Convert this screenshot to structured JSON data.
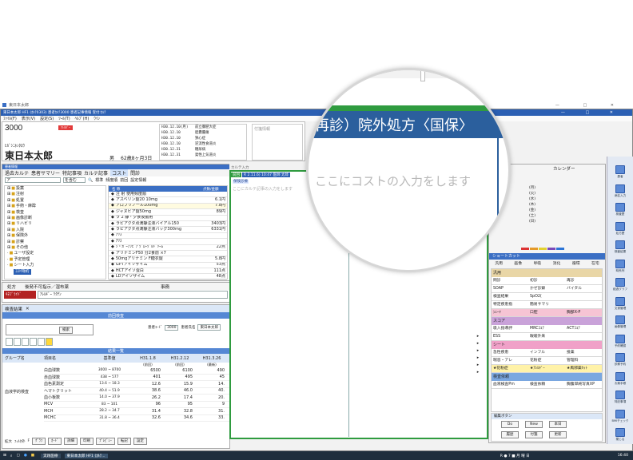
{
  "app": {
    "outer_title": "東日本太郎",
    "title": "東日本太郎 HF1 (ｶﾙﾃ0303) 患者ｶﾙﾃ3000 患者記事情報 受付:ｶﾙﾃ",
    "menus": [
      "ﾌｧｲﾙ(F)",
      "表示(V)",
      "設定(S)",
      "ﾂｰﾙ(T)",
      "ﾍﾙﾌﾟ(H)",
      "ｳｲﾝ"
    ]
  },
  "patient": {
    "id": "3000",
    "badge": "ｱﾚﾙｷﾞｰ",
    "kana": "ﾋｶﾞｼﾆﾎﾝﾀﾛｳ",
    "name": "東日本太郎",
    "sex": "男",
    "age": "62歳8ヶ月3日",
    "dates": [
      {
        "d": "H30.12.10(月)",
        "t": "前立腺肥大症"
      },
      {
        "d": "H30.12.10",
        "t": "胆嚢腫瘍"
      },
      {
        "d": "H30.12.10",
        "t": "狭心症"
      },
      {
        "d": "H30.12.10",
        "t": "逆流性食道炎"
      },
      {
        "d": "H30.12.31",
        "t": "糖尿病"
      },
      {
        "d": "H30.12.31",
        "t": "発性上気道炎"
      }
    ],
    "sticky": "付箋情報"
  },
  "left_panel": {
    "title": "患者情報",
    "tabs": [
      "過去カルテ",
      "患者サマリー",
      "特記事項",
      "カルテ記事",
      "コスト",
      "問診"
    ],
    "search_value": "ア",
    "search_mode": "を含む",
    "std_label": "標準",
    "checks": [
      "頻度順",
      "前回"
    ],
    "settings_label": "設定情報",
    "tree": [
      "投薬",
      "注射",
      "処置",
      "手術・麻酔",
      "検査",
      "画像診断",
      "リハビリ",
      "入院",
      "保険外",
      "診察",
      "その他",
      "ユーザ設定",
      "予定管理",
      "シート入力"
    ],
    "tree_selected": "ｺｽﾄ特約",
    "list_header": [
      "名 称",
      "点数/金額"
    ],
    "list": [
      {
        "n": "注 射 使用頻度順",
        "v": ""
      },
      {
        "n": "アスベリン錠20 10mg",
        "v": "6.1円"
      },
      {
        "n": "アロプリノール100mg",
        "v": "7.8円"
      },
      {
        "n": "ジャヌビア錠50mg",
        "v": "89円"
      },
      {
        "n": "ラ 2 静・夕食後服用",
        "v": ""
      },
      {
        "n": "ラピアクタ点滴静注液バイアル150",
        "v": "3403円"
      },
      {
        "n": "ラピアクタ点滴静注液バッグ300mg",
        "v": "6331円"
      },
      {
        "n": "ｱﾘｽ",
        "v": ""
      },
      {
        "n": "ｱﾘｽ",
        "v": ""
      },
      {
        "n": "ｼ・ｶﾞｰｱﾝﾋﾞｱ ｸﾞﾛｰｸﾞﾙﾄﾞﾘｰﾑ",
        "v": "22点"
      },
      {
        "n": "アリナミンF50 分2食前 ×7",
        "v": ""
      },
      {
        "n": "50mgアリナミン F糖衣錠",
        "v": "5.8円"
      },
      {
        "n": "GPTアイソザイム",
        "v": "53点"
      },
      {
        "n": "HCTアイソ蛋白",
        "v": "111点"
      },
      {
        "n": "LDアイソザイム",
        "v": "48点"
      }
    ],
    "memo_cols": [
      "処方",
      "後発不可指示／湿布薬",
      "事務"
    ],
    "memo_tag": "ｷﾈﾌﾞﾗｲﾄﾞ",
    "memo_text": "ｱﾚﾙｷﾞｰ ﾜｸﾁﾝ"
  },
  "results": {
    "tab": "検査結果",
    "header": "前回検査",
    "labels": {
      "item": "項目名",
      "range": "基準値",
      "group": "グループ名",
      "group_value": "血液学的検査",
      "code_label": "患者ｺｰﾄﾞ",
      "code": "3000",
      "name_label": "患者氏名",
      "name": "東日本太郎",
      "table_title": "結果一覧",
      "btn": "検索"
    },
    "dates": [
      "H31.1.8",
      "H31.2.12",
      "H31.3.26"
    ],
    "sub": [
      "(前回)",
      "(前回)",
      "(最新)"
    ],
    "rows": [
      {
        "n": "白血球数",
        "r": "3000 ~ 8700",
        "v": [
          "6500",
          "6100",
          "490"
        ]
      },
      {
        "n": "赤血球数",
        "r": "438 ~ 577",
        "v": [
          "401",
          "495",
          "45"
        ]
      },
      {
        "n": "血色素測定",
        "r": "13.6 ~ 18.3",
        "v": [
          "12.6",
          "15.9",
          "14."
        ]
      },
      {
        "n": "ヘマトクリット",
        "r": "40.4 ~ 51.9",
        "v": [
          "38.6",
          "46.0",
          "40."
        ]
      },
      {
        "n": "血小板数",
        "r": "14.0 ~ 37.9",
        "v": [
          "26.2",
          "17.4",
          "20."
        ]
      },
      {
        "n": "MCV",
        "r": "83 ~ 101",
        "v": [
          "96",
          "95",
          "9"
        ]
      },
      {
        "n": "MCH",
        "r": "28.2 ~ 34.7",
        "v": [
          "31.4",
          "32.8",
          "31."
        ]
      },
      {
        "n": "MCHC",
        "r": "31.8 ~ 36.4",
        "v": [
          "32.6",
          "34.6",
          "33."
        ]
      }
    ],
    "footer_checks": [
      "拡大",
      "ﾌｨﾙﾀ外",
      "F"
    ],
    "footer_buttons": [
      "ｸﾞﾗﾌ",
      "ｶｰﾄﾞ",
      "詳細",
      "印刷",
      "ﾌﾟﾚﾋﾞｭｰ",
      "転記",
      "設定"
    ]
  },
  "karte": {
    "tab_active": "前回",
    "line": "R 2.11.6) 10:47 医師 太郎",
    "sub_tag": "保険診療",
    "placeholder": "ここにカルテ記事の入力をします",
    "title_hint": "カルテ入力"
  },
  "magnifier": {
    "order_text": "再診）院外処方〈国保〉",
    "cost_placeholder": "ここにコストの入力をします"
  },
  "right_panel": {
    "calendar_title": "カレンダー",
    "weekdays": [
      "(月)",
      "(火)",
      "(水)",
      "(木)",
      "(金)",
      "(土)",
      "(日)"
    ],
    "shortcut_title": "ショートカット",
    "tabs": [
      "汎用",
      "画像",
      "呼吸",
      "消化",
      "循環",
      "在宅"
    ],
    "sections": [
      {
        "type": "head",
        "label": "汎用",
        "color": "#e9d6a6"
      },
      {
        "type": "row",
        "cells": [
          "問診",
          "初診",
          "再診"
        ]
      },
      {
        "type": "row",
        "cells": [
          "SOAP",
          "かぜ診察",
          "バイタル"
        ]
      },
      {
        "type": "row",
        "cells": [
          "検査結果",
          "SpO2(",
          ""
        ]
      },
      {
        "type": "row",
        "cells": [
          "特定疾患指",
          "簡易サマリ",
          ""
        ]
      },
      {
        "type": "pinkrow",
        "cells": [
          "ｼｪｰﾏ",
          "口腔",
          "胸部X-P"
        ]
      },
      {
        "type": "head",
        "label": "スコア",
        "color": "#c9a2d9"
      },
      {
        "type": "row",
        "cells": [
          "吸入指導評",
          "MRCｽｺｱ",
          "ACTｽｺｱ"
        ]
      },
      {
        "type": "row",
        "cells": [
          "ESS",
          "眼嘘外来",
          ""
        ]
      },
      {
        "type": "head",
        "label": "シート",
        "color": "#f0a1c8"
      },
      {
        "type": "row",
        "cells": [
          "急性疾患",
          "インフル",
          "投薬"
        ]
      },
      {
        "type": "row",
        "cells": [
          "喘息・アレ",
          "花粉症",
          "管理料"
        ]
      },
      {
        "type": "yellowrow",
        "cells": [
          "★花粉症",
          "★ｱﾚﾙｷﾞｰ",
          "★風邪薬ｾｯﾄ"
        ]
      },
      {
        "type": "head",
        "label": "検査依頼",
        "color": "#7aa7e0"
      },
      {
        "type": "row",
        "cells": [
          "血液検査Pm",
          "検査依頼",
          "胸腹単純写真XP"
        ]
      }
    ],
    "edit_title": "編集ボタン",
    "edit_buttons": [
      "Do",
      "New",
      "本日",
      "履歴",
      "付箋",
      "更新"
    ]
  },
  "sidebar": {
    "items": [
      "患者",
      "病名入力",
      "検査歴",
      "処方歴",
      "検査結果",
      "時系列",
      "経過グラフ",
      "文書管理",
      "画像管理",
      "予約確認",
      "診察予約",
      "お薬手帳",
      "特記事項",
      "BMIチェック",
      "閉じる"
    ]
  },
  "taskbar": {
    "apps": [
      "実践医療",
      "東日本太郎 HF1 (ｶﾙﾃ..."
    ],
    "tray": "R ● 7 ■ 月 曜 日",
    "time": "16:40"
  },
  "colors": {
    "title_bar": "#2b5fb3",
    "accent": "#3b6fc4",
    "karte_border": "#2f9b3f",
    "taskbar": "#1f2e3d"
  }
}
